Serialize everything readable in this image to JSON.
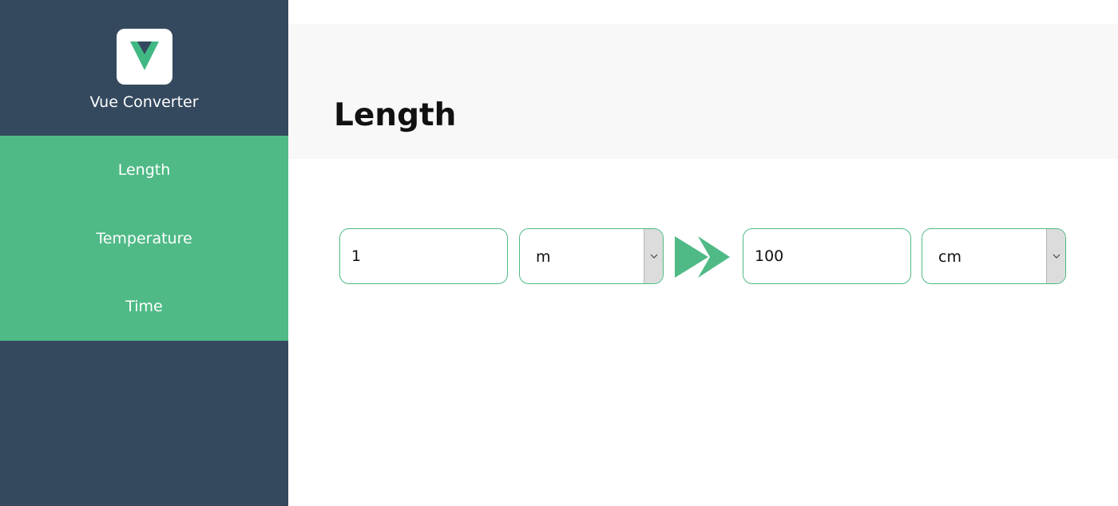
{
  "app": {
    "name": "Vue Converter",
    "logo_icon": "vue-logo-icon"
  },
  "sidebar": {
    "items": [
      {
        "label": "Length"
      },
      {
        "label": "Temperature"
      },
      {
        "label": "Time"
      }
    ]
  },
  "main": {
    "title": "Length",
    "converter": {
      "from_value": "1",
      "from_unit": "m",
      "to_value": "100",
      "to_unit": "cm",
      "arrow_icon": "double-chevron-right-icon"
    }
  },
  "colors": {
    "sidebar_bg": "#34495e",
    "accent": "#4fba86",
    "header_bg": "#f8f8f8"
  }
}
